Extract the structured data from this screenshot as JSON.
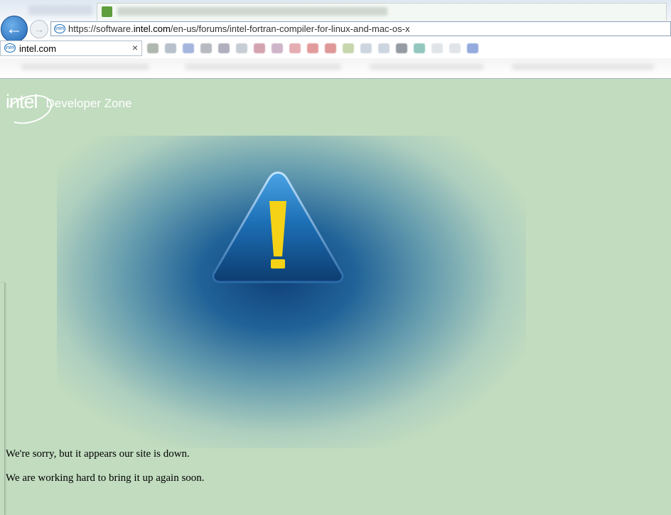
{
  "browser": {
    "url_prefix": "https://software.",
    "url_domain": "intel.com",
    "url_path": "/en-us/forums/intel-fortran-compiler-for-linux-and-mac-os-x",
    "tab_title": "intel.com",
    "tab_close": "×",
    "back_arrow": "←",
    "forward_arrow": "→",
    "favicon_text": "intel",
    "icons": [
      "back-icon",
      "forward-icon",
      "favicon-icon",
      "close-icon"
    ]
  },
  "page": {
    "logo_word": "intel",
    "logo_subtitle": "Developer Zone",
    "warning_icon": "warning-triangle-icon",
    "message_line1": "We're sorry, but it appears our site is down.",
    "message_line2": "We are working hard to bring it up again soon."
  },
  "colors": {
    "background": "#c1dcbf",
    "glow": "#0e4078",
    "warning_fill": "#1a6cb0",
    "exclamation": "#f5d216"
  }
}
